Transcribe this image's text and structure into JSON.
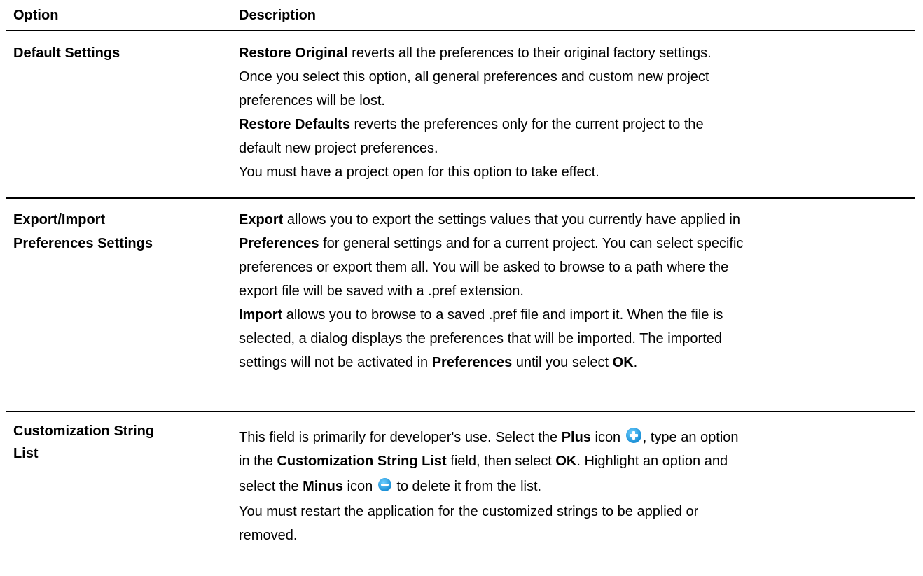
{
  "header": {
    "option": "Option",
    "description": "Description"
  },
  "rows": [
    {
      "option": "Default Settings",
      "lines": [
        {
          "bold": "Restore Original",
          "text": " reverts all the preferences to their original factory settings."
        },
        {
          "text": "Once you select this option, all general preferences and custom new project"
        },
        {
          "text": "preferences will be lost."
        },
        {
          "bold": "Restore Defaults",
          "text": " reverts the preferences only for the current project to the"
        },
        {
          "text": "default new project preferences."
        },
        {
          "text": "You must have a project open for this option to take effect."
        }
      ]
    },
    {
      "option_line1": "Export/Import",
      "option_line2": "Preferences Settings",
      "lines": [
        {
          "bold": "Export",
          "text": " allows you to export the settings values that you currently have applied in"
        },
        {
          "bold": "Preferences",
          "text": " for general settings and for a current project. You can select specific"
        },
        {
          "text": "preferences or export them all. You will be asked to browse to a path where the"
        },
        {
          "text": "export file will be saved with a .pref extension."
        },
        {
          "bold": "Import",
          "text": " allows you to browse to a saved .pref file and import it. When the file is"
        },
        {
          "text": "selected, a dialog displays the preferences that will be imported. The imported"
        },
        {
          "pre": "settings will not be activated in ",
          "bold": "Preferences",
          "mid": " until you select ",
          "bold2": "OK",
          "post": "."
        }
      ]
    },
    {
      "option_line1": "Customization String",
      "option_line2": "List",
      "line1": {
        "pre": "This field is primarily for developer's use. Select the ",
        "bold": "Plus",
        "mid": " icon ",
        "post": ", type an option"
      },
      "line2": {
        "pre": "in the ",
        "bold": "Customization String List",
        "mid": " field, then select ",
        "bold2": "OK",
        "post": ". Highlight an option and"
      },
      "line3": {
        "pre": "select the ",
        "bold": "Minus",
        "mid": " icon ",
        "post": " to delete it from the list."
      },
      "line4": "You must restart the application for the customized strings to be applied or",
      "line5": "removed.",
      "icons": [
        "plus-circle-icon",
        "minus-circle-icon"
      ],
      "icon_color": "#1a8fd6"
    }
  ]
}
